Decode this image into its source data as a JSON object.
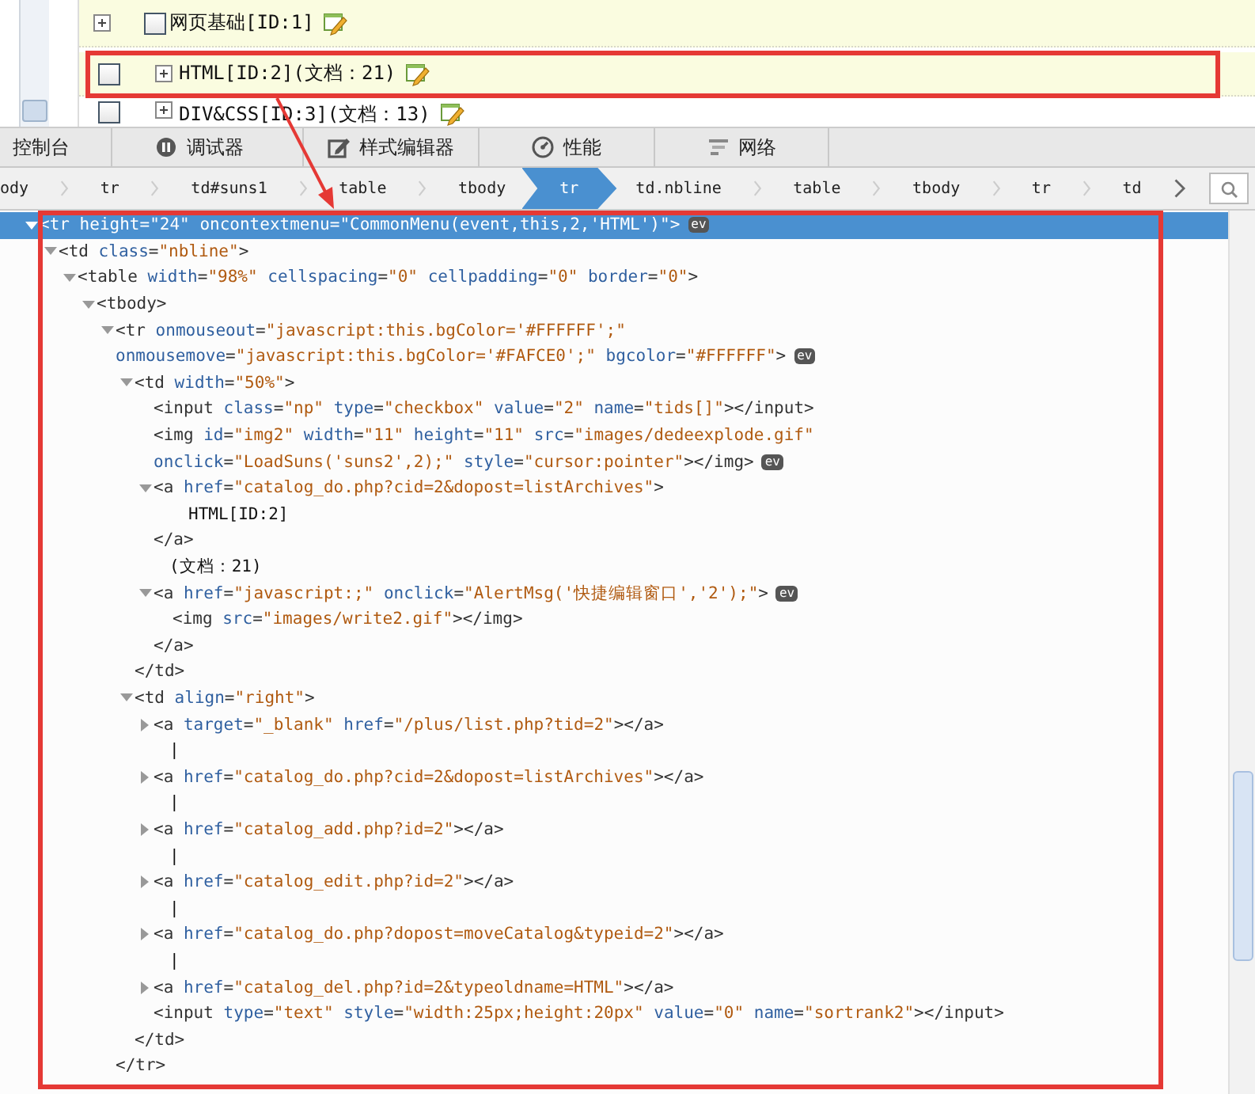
{
  "page_rows": [
    {
      "kind": "root",
      "label": "网页基础[ID:1]",
      "checked": false,
      "highlighted": true
    },
    {
      "kind": "child",
      "label": "HTML[ID:2](文档：21)",
      "checked": false,
      "highlighted": true
    },
    {
      "kind": "child",
      "label": "DIV&CSS[ID:3](文档：13)",
      "checked": false,
      "highlighted": false
    }
  ],
  "devtools_tabs": [
    {
      "kind": "partial",
      "label": "控制台",
      "selected": false
    },
    {
      "kind": "debugger",
      "label": "调试器",
      "selected": false
    },
    {
      "kind": "style",
      "label": "样式编辑器",
      "selected": false
    },
    {
      "kind": "performance",
      "label": "性能",
      "selected": false
    },
    {
      "kind": "network",
      "label": "网络",
      "selected": false
    }
  ],
  "breadcrumbs": [
    {
      "label": "ody",
      "selected": false
    },
    {
      "label": "tr",
      "selected": false
    },
    {
      "label": "td#suns1",
      "selected": false
    },
    {
      "label": "table",
      "selected": false
    },
    {
      "label": "tbody",
      "selected": false
    },
    {
      "label": "tr",
      "selected": true
    },
    {
      "label": "td.nbline",
      "selected": false
    },
    {
      "label": "table",
      "selected": false
    },
    {
      "label": "tbody",
      "selected": false
    },
    {
      "label": "tr",
      "selected": false
    },
    {
      "label": "td",
      "selected": false
    }
  ],
  "markup_tree": [
    {
      "expanded": true,
      "selected": true,
      "ev_badge": "ev",
      "lines": [
        "<tr height=\"24\" oncontextmenu=\"CommonMenu(event,this,2,'HTML')\">"
      ],
      "children": [
        {
          "expanded": true,
          "selected": false,
          "lines": [
            "<td class=\"nbline\">"
          ],
          "children": [
            {
              "expanded": true,
              "selected": false,
              "lines": [
                "<table width=\"98%\" cellspacing=\"0\" cellpadding=\"0\" border=\"0\">"
              ],
              "children": [
                {
                  "expanded": true,
                  "selected": false,
                  "lines": [
                    "<tbody>"
                  ],
                  "children": [
                    {
                      "expanded": true,
                      "selected": false,
                      "ev_badge": "ev",
                      "lines": [
                        "<tr onmouseout=\"javascript:this.bgColor='#FFFFFF';\"",
                        "onmousemove=\"javascript:this.bgColor='#FAFCE0';\" bgcolor=\"#FFFFFF\">"
                      ],
                      "close": "</tr>",
                      "children": [
                        {
                          "expanded": true,
                          "selected": false,
                          "lines": [
                            "<td width=\"50%\">"
                          ],
                          "close": "</td>",
                          "children": [
                            {
                              "selected": false,
                              "lines": [
                                "<input class=\"np\" type=\"checkbox\" value=\"2\" name=\"tids[]\"></input>"
                              ]
                            },
                            {
                              "selected": false,
                              "ev_badge": "ev",
                              "lines": [
                                "<img id=\"img2\" width=\"11\" height=\"11\" src=\"images/dedeexplode.gif\"",
                                "onclick=\"LoadSuns('suns2',2);\" style=\"cursor:pointer\"></img>"
                              ]
                            },
                            {
                              "expanded": true,
                              "selected": false,
                              "lines": [
                                "<a href=\"catalog_do.php?cid=2&dopost=listArchives\">"
                              ],
                              "close": "</a>",
                              "children": [
                                {
                                  "text": "HTML[ID:2]"
                                }
                              ]
                            },
                            {
                              "text": "(文档：21)"
                            },
                            {
                              "expanded": true,
                              "selected": false,
                              "ev_badge": "ev",
                              "lines": [
                                "<a href=\"javascript:;\" onclick=\"AlertMsg('快捷编辑窗口','2');\">"
                              ],
                              "close": "</a>",
                              "children": [
                                {
                                  "selected": false,
                                  "lines": [
                                    "<img src=\"images/write2.gif\"></img>"
                                  ]
                                }
                              ]
                            }
                          ]
                        },
                        {
                          "expanded": true,
                          "selected": false,
                          "lines": [
                            "<td align=\"right\">"
                          ],
                          "close": "</td>",
                          "children": [
                            {
                              "expanded": false,
                              "selected": false,
                              "lines": [
                                "<a target=\"_blank\" href=\"/plus/list.php?tid=2\"></a>"
                              ]
                            },
                            {
                              "text": "|"
                            },
                            {
                              "expanded": false,
                              "selected": false,
                              "lines": [
                                "<a href=\"catalog_do.php?cid=2&dopost=listArchives\"></a>"
                              ]
                            },
                            {
                              "text": "|"
                            },
                            {
                              "expanded": false,
                              "selected": false,
                              "lines": [
                                "<a href=\"catalog_add.php?id=2\"></a>"
                              ]
                            },
                            {
                              "text": "|"
                            },
                            {
                              "expanded": false,
                              "selected": false,
                              "lines": [
                                "<a href=\"catalog_edit.php?id=2\"></a>"
                              ]
                            },
                            {
                              "text": "|"
                            },
                            {
                              "expanded": false,
                              "selected": false,
                              "lines": [
                                "<a href=\"catalog_do.php?dopost=moveCatalog&typeid=2\"></a>"
                              ]
                            },
                            {
                              "text": "|"
                            },
                            {
                              "expanded": false,
                              "selected": false,
                              "lines": [
                                "<a href=\"catalog_del.php?id=2&typeoldname=HTML\"></a>"
                              ]
                            },
                            {
                              "selected": false,
                              "lines": [
                                "<input type=\"text\" style=\"width:25px;height:20px\" value=\"0\" name=\"sortrank2\"></input>"
                              ]
                            }
                          ]
                        }
                      ]
                    }
                  ]
                }
              ]
            }
          ]
        }
      ]
    }
  ]
}
